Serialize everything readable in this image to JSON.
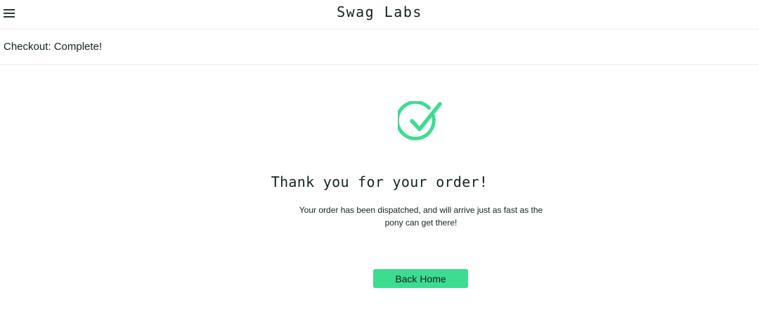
{
  "header": {
    "app_title": "Swag Labs",
    "menu_icon": "hamburger-menu-icon"
  },
  "secondary_header": {
    "title": "Checkout: Complete!"
  },
  "checkout_complete": {
    "icon": "checkmark-circle-icon",
    "heading": "Thank you for your order!",
    "message": "Your order has been dispatched, and will arrive just as fast as the pony can get there!",
    "back_home_label": "Back Home"
  },
  "colors": {
    "accent_green": "#3ddc91",
    "text_dark": "#132322",
    "divider": "#ededed"
  }
}
